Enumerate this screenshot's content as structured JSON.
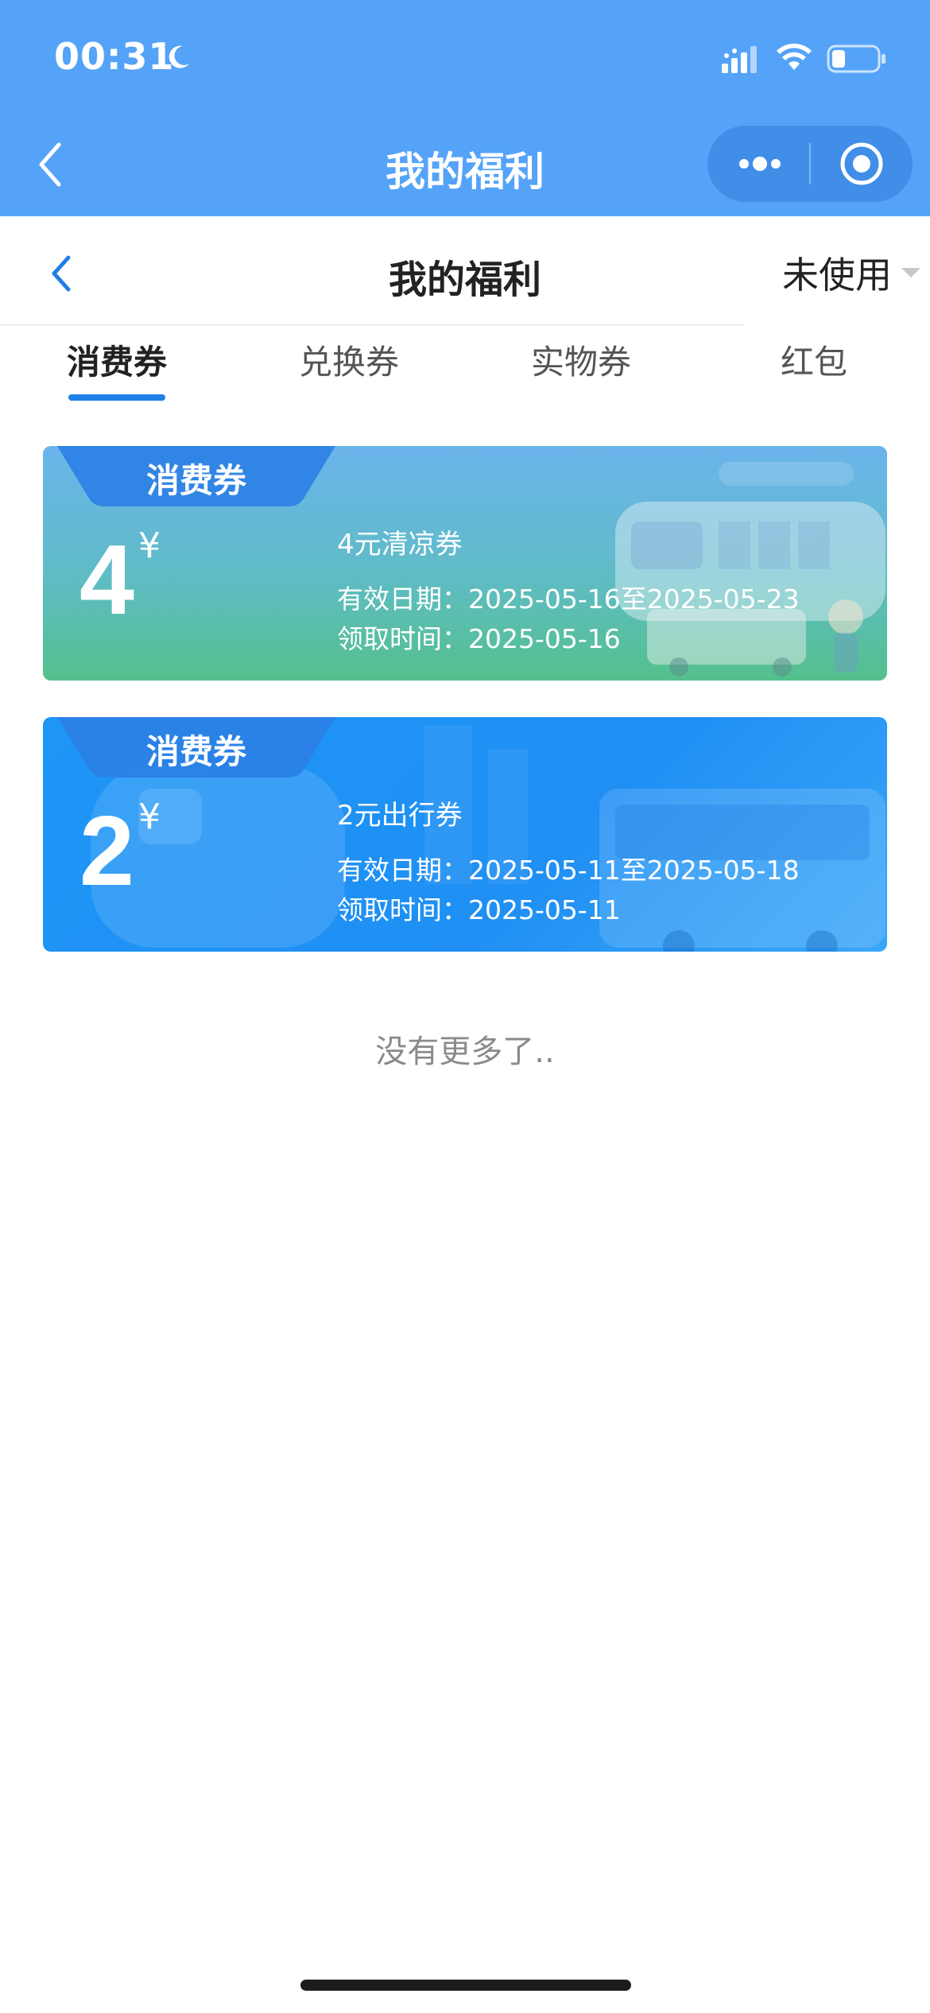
{
  "status_bar": {
    "time": "00:31",
    "icons": [
      "moon-icon",
      "signal-icon",
      "wifi-icon",
      "battery-icon"
    ]
  },
  "nav": {
    "title": "我的福利",
    "icons": [
      "back-icon",
      "more-icon",
      "target-icon"
    ]
  },
  "subheader": {
    "title": "我的福利",
    "filter_label": "未使用"
  },
  "tabs": [
    {
      "label": "消费券",
      "active": true
    },
    {
      "label": "兑换券",
      "active": false
    },
    {
      "label": "实物券",
      "active": false
    },
    {
      "label": "红包",
      "active": false
    }
  ],
  "coupons": [
    {
      "tag": "消费券",
      "amount": "4",
      "currency": "¥",
      "name": "4元清凉券",
      "valid": "有效日期：2025-05-16至2025-05-23",
      "received": "领取时间：2025-05-16"
    },
    {
      "tag": "消费券",
      "amount": "2",
      "currency": "¥",
      "name": "2元出行券",
      "valid": "有效日期：2025-05-11至2025-05-18",
      "received": "领取时间：2025-05-11"
    }
  ],
  "footer_text": "没有更多了..",
  "colors": {
    "nav_blue": "#55a3f8",
    "tab_active_indicator": "#1f7fe8",
    "coupon1_gradient": [
      "#6bb4ec",
      "#54c08c"
    ],
    "coupon2_gradient": [
      "#1e96f6",
      "#3aa6f8"
    ],
    "tag_blue": "#2b7fe6"
  }
}
